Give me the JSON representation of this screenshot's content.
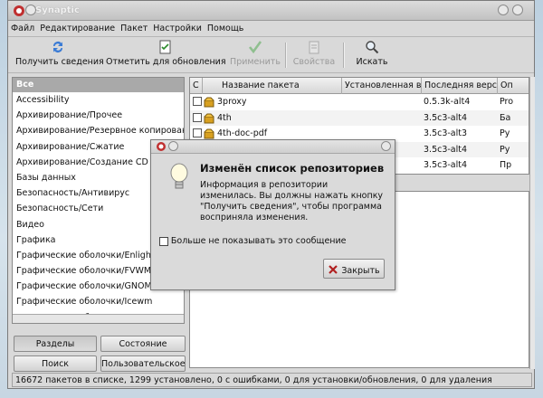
{
  "window": {
    "title": "Synaptic"
  },
  "menu": [
    "Файл",
    "Редактирование",
    "Пакет",
    "Настройки",
    "Помощь"
  ],
  "toolbar": {
    "refresh": "Получить сведения",
    "mark_upgrades": "Отметить для обновления",
    "apply": "Применить",
    "properties": "Свойства",
    "search": "Искать"
  },
  "sections": {
    "header": "Все",
    "items": [
      "Accessibility",
      "Архивирование/Прочее",
      "Архивирование/Резервное копирован",
      "Архивирование/Сжатие",
      "Архивирование/Создание CD",
      "Базы данных",
      "Безопасность/Антивирус",
      "Безопасность/Сети",
      "Видео",
      "Графика",
      "Графические оболочки/Enlighten",
      "Графические оболочки/FVWM-ba",
      "Графические оболочки/GNOME",
      "Графические оболочки/Icewm",
      "Графические оболочки/KDE"
    ]
  },
  "filter_buttons": {
    "sections": "Разделы",
    "status": "Состояние",
    "search": "Поиск",
    "custom": "Пользовательское"
  },
  "table": {
    "headers": {
      "s": "С",
      "name": "Название пакета",
      "installed": "Установленная ве",
      "latest": "Последняя версия",
      "desc": "Оп"
    },
    "rows": [
      {
        "name": "3proxy",
        "latest": "0.5.3k-alt4",
        "desc": "Pro"
      },
      {
        "name": "4th",
        "latest": "3.5c3-alt4",
        "desc": "Ба"
      },
      {
        "name": "4th-doc-pdf",
        "latest": "3.5c3-alt3",
        "desc": "Ру"
      },
      {
        "name": "",
        "latest": "3.5c3-alt4",
        "desc": "Ру"
      },
      {
        "name": "",
        "latest": "3.5c3-alt4",
        "desc": "Пр"
      }
    ]
  },
  "status_bar": "16672 пакетов в списке, 1299 установлено, 0 с ошибками, 0 для установки/обновления, 0 для удаления",
  "dialog": {
    "heading": "Изменён список репозиториев",
    "body": "Информация в репозитории изменилась. Вы должны нажать кнопку \"Получить сведения\", чтобы программа восприняла изменения.",
    "checkbox_label": "Больше не показывать это сообщение",
    "close_button": "Закрыть"
  }
}
